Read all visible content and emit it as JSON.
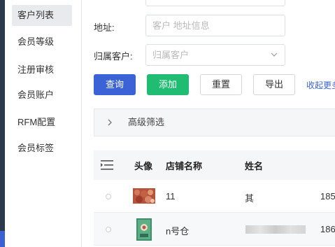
{
  "sidebar": {
    "items": [
      {
        "label": "客户列表",
        "active": true
      },
      {
        "label": "会员等级",
        "active": false
      },
      {
        "label": "注册审核",
        "active": false
      },
      {
        "label": "会员账户",
        "active": false
      },
      {
        "label": "RFM配置",
        "active": false
      },
      {
        "label": "会员标签",
        "active": false
      }
    ]
  },
  "filters": {
    "address_label": "地址:",
    "address_placeholder": "客户 地址信息",
    "owner_label": "归属客户:",
    "owner_placeholder": "归属客户"
  },
  "toolbar": {
    "query_label": "查询",
    "add_label": "添加",
    "reset_label": "重置",
    "export_label": "导出",
    "collapse_label": "收起更多"
  },
  "advanced_filter": {
    "label": "高级筛选"
  },
  "table": {
    "columns": [
      "头像",
      "店铺名称",
      "姓名"
    ],
    "rows": [
      {
        "shop": "11",
        "name": "其",
        "phone_partial": "185"
      },
      {
        "shop": "n号仓",
        "name": "",
        "phone_partial": "186"
      }
    ]
  },
  "colors": {
    "primary": "#3b63d6",
    "success": "#1fbc72",
    "sidebar_dark": "#2d3a4b"
  }
}
